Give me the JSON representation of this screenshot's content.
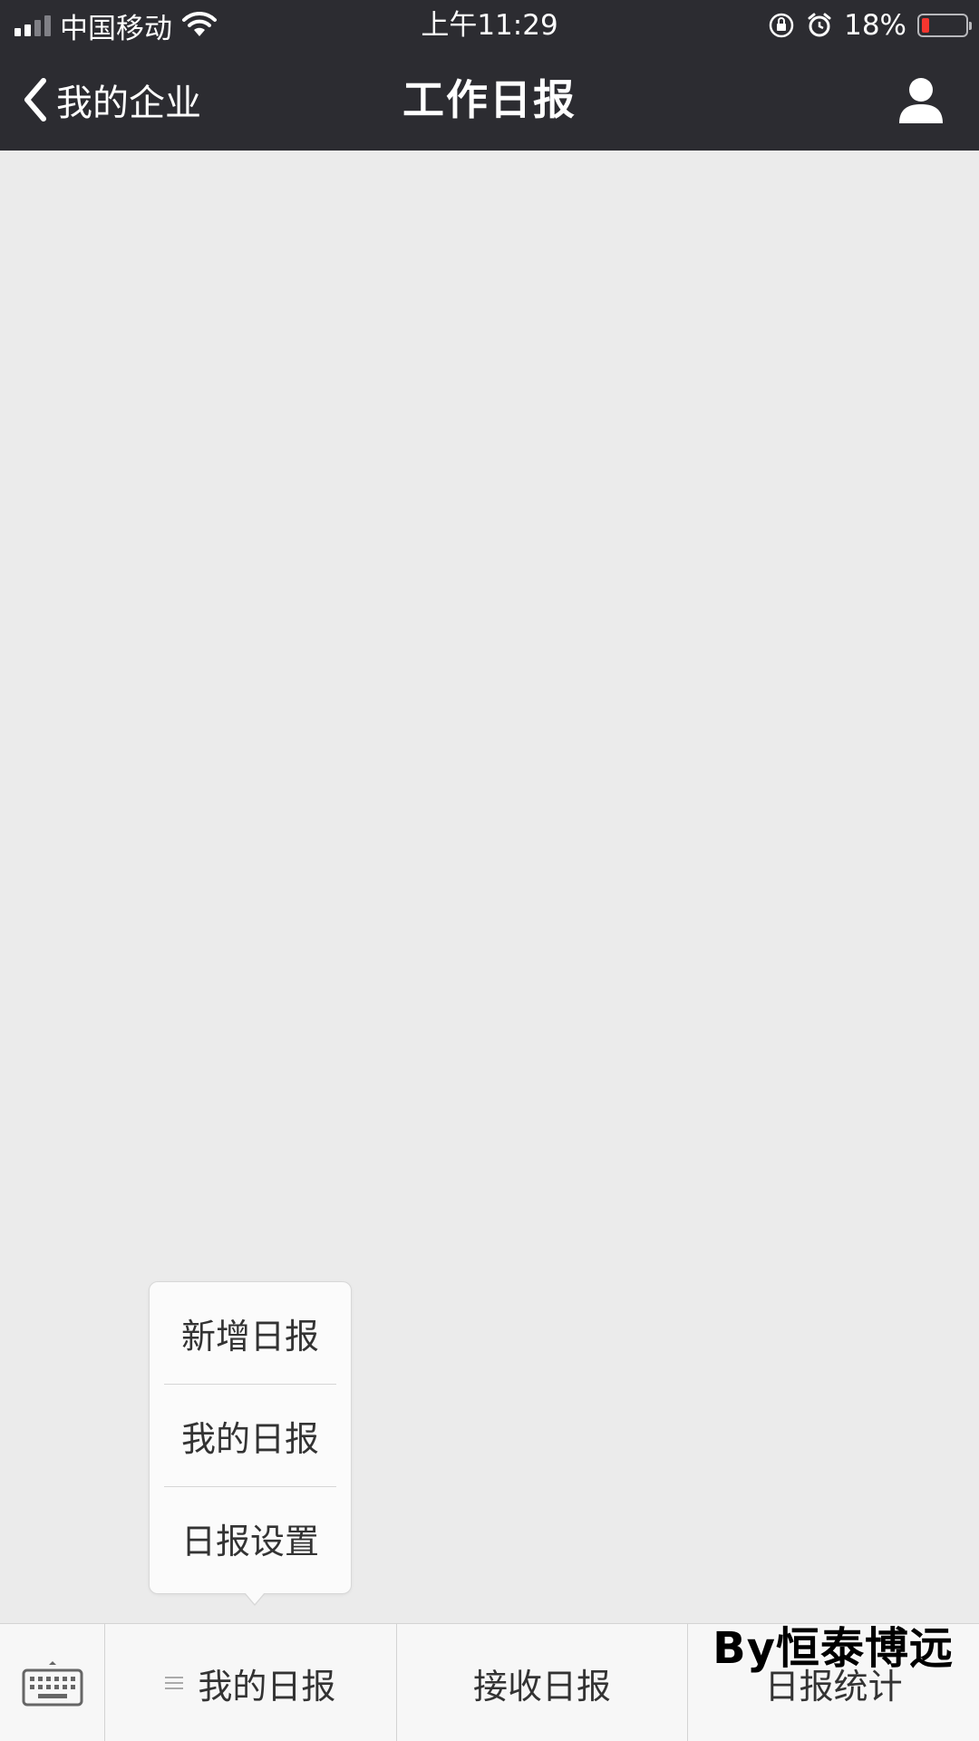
{
  "status_bar": {
    "carrier": "中国移动",
    "time": "上午11:29",
    "battery_percent": "18%",
    "battery_level": 0.18,
    "icons": [
      "signal-icon",
      "wifi-icon",
      "rotation-lock-icon",
      "alarm-icon",
      "battery-icon"
    ]
  },
  "nav": {
    "back_label": "我的企业",
    "title": "工作日报",
    "profile_icon": "user-icon"
  },
  "popup_menu": {
    "items": [
      "新增日报",
      "我的日报",
      "日报设置"
    ]
  },
  "bottom_bar": {
    "keyboard_icon": "keyboard-icon",
    "tabs": [
      {
        "label": "我的日报",
        "icon": "menu-icon"
      },
      {
        "label": "接收日报"
      },
      {
        "label": "日报统计"
      }
    ]
  },
  "watermark": "By恒泰博远",
  "colors": {
    "header_bg": "#2c2c31",
    "content_bg": "#ebebeb",
    "battery_low": "#f5362f"
  }
}
